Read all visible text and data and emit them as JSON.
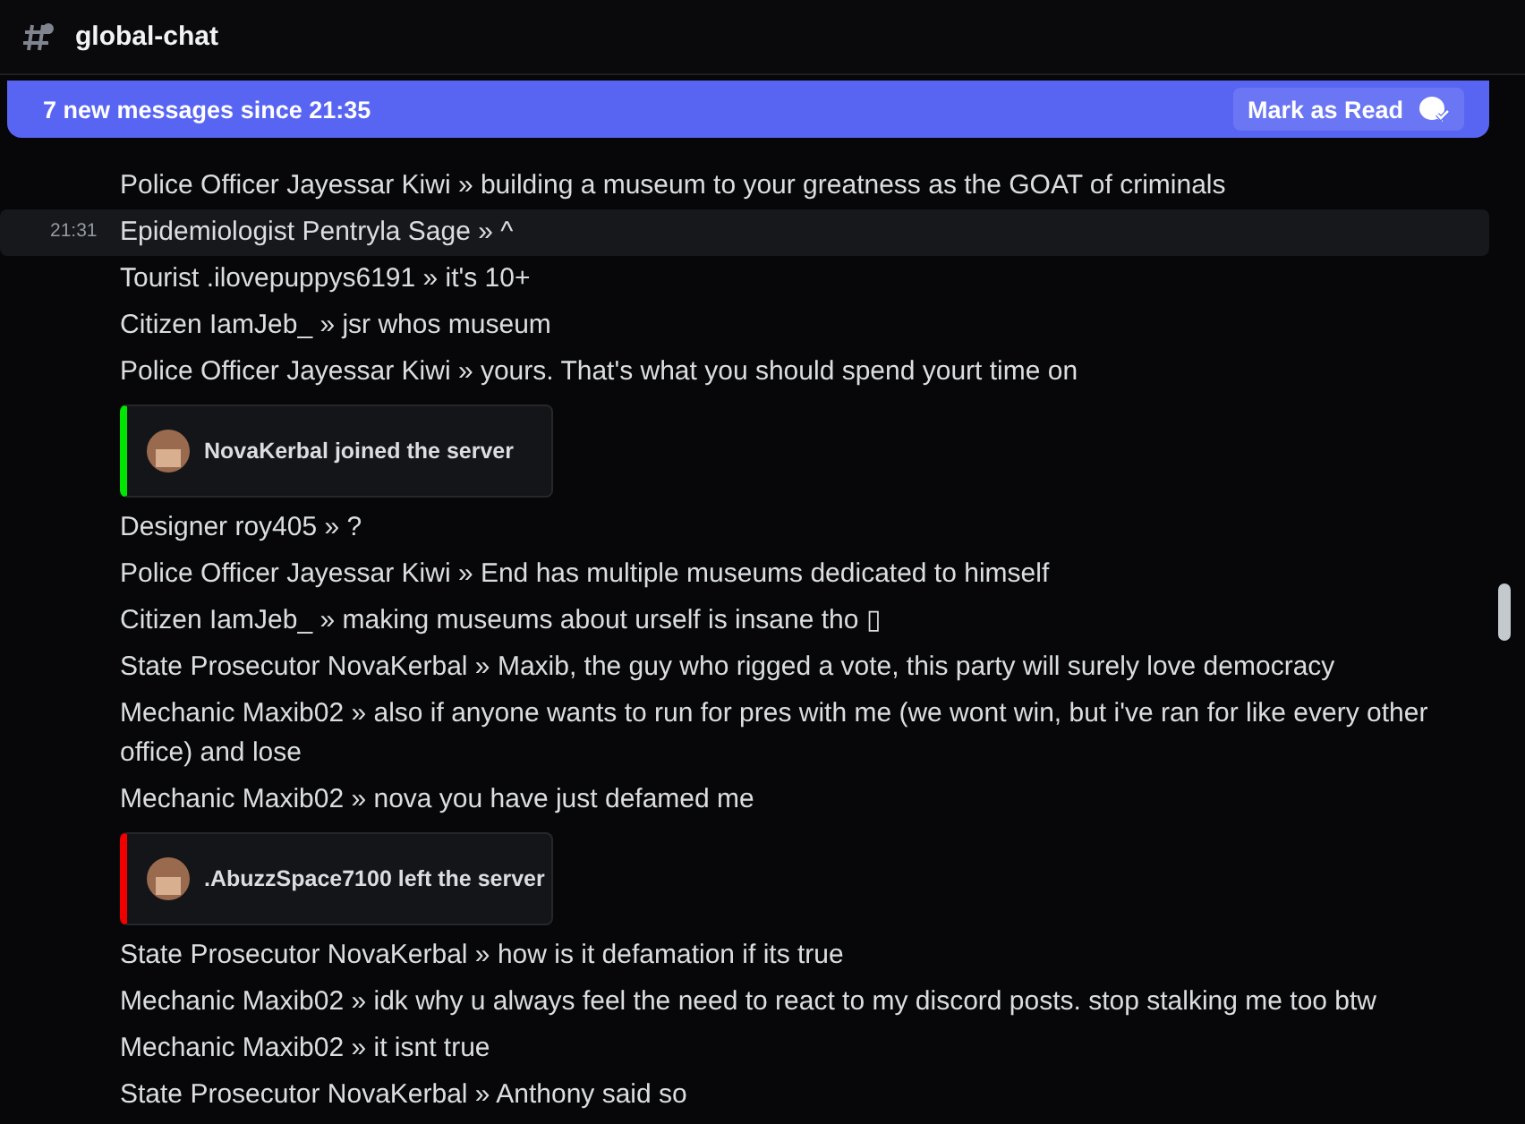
{
  "channel": {
    "name": "global-chat"
  },
  "banner": {
    "text": "7 new messages since 21:35",
    "button": "Mark as Read"
  },
  "messages": [
    {
      "kind": "text",
      "highlighted": false,
      "text": "Police Officer Jayessar Kiwi » building a museum to your greatness as the GOAT of criminals"
    },
    {
      "kind": "text",
      "highlighted": true,
      "time": "21:31",
      "text": "Epidemiologist Pentryla Sage » ^"
    },
    {
      "kind": "text",
      "highlighted": false,
      "text": "Tourist .ilovepuppys6191 » it's 10+"
    },
    {
      "kind": "text",
      "highlighted": false,
      "text": "Citizen IamJeb_ » jsr whos museum"
    },
    {
      "kind": "text",
      "highlighted": false,
      "text": "Police Officer Jayessar Kiwi » yours. That's what you should spend yourt time on"
    },
    {
      "kind": "system",
      "color": "#00e600",
      "text": "NovaKerbal joined the server"
    },
    {
      "kind": "text",
      "highlighted": false,
      "text": "Designer roy405 » ?"
    },
    {
      "kind": "text",
      "highlighted": false,
      "text": "Police Officer Jayessar Kiwi » End has multiple museums dedicated to himself"
    },
    {
      "kind": "text",
      "highlighted": false,
      "text": "Citizen IamJeb_ » making museums about urself is insane tho ▯"
    },
    {
      "kind": "text",
      "highlighted": false,
      "text": "State Prosecutor NovaKerbal » Maxib, the guy who rigged a vote, this party will surely love democracy"
    },
    {
      "kind": "text",
      "highlighted": false,
      "text": "Mechanic Maxib02 » also if anyone wants to run for pres with me (we wont win, but i've ran for like every other office) and lose"
    },
    {
      "kind": "text",
      "highlighted": false,
      "text": "Mechanic Maxib02 » nova you have just defamed me"
    },
    {
      "kind": "system",
      "color": "#f20000",
      "text": ".AbuzzSpace7100 left the server"
    },
    {
      "kind": "text",
      "highlighted": false,
      "text": "State Prosecutor NovaKerbal » how is it defamation if its true"
    },
    {
      "kind": "text",
      "highlighted": false,
      "text": "Mechanic Maxib02 » idk why u always feel the need to react to my discord posts. stop stalking me too btw"
    },
    {
      "kind": "text",
      "highlighted": false,
      "text": "Mechanic Maxib02 » it isnt true"
    },
    {
      "kind": "text",
      "highlighted": false,
      "text": "State Prosecutor NovaKerbal » Anthony said so"
    }
  ]
}
